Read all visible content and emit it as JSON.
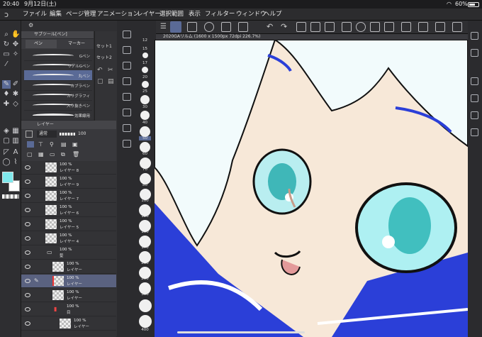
{
  "status": {
    "time": "20:40",
    "date": "9月12日(土)",
    "battery": "60%"
  },
  "menu": [
    "ファイル",
    "編集",
    "ページ管理",
    "アニメーション",
    "レイヤー",
    "選択範囲",
    "表示",
    "フィルター",
    "ウィンドウ",
    "ヘルプ"
  ],
  "subtool": {
    "title": "サブツール[ペン]",
    "tabs": [
      "ペン",
      "マーカー"
    ],
    "brushes": [
      "Gペン",
      "リアルGペン",
      "丸ペン",
      "カブラペン",
      "カリグラフィ",
      "入り抜きペン",
      "効果線用"
    ],
    "selected": 2
  },
  "sets": {
    "items": [
      "セット1",
      "セット2"
    ]
  },
  "sizes": [
    "12",
    "15",
    "17",
    "20",
    "25",
    "30",
    "40",
    "50",
    "60",
    "70",
    "80",
    "100",
    "120",
    "150",
    "170",
    "200",
    "250",
    "300",
    "400"
  ],
  "selected_size": "50",
  "layer_panel": {
    "title": "レイヤー",
    "blend": "通常",
    "opacity": "100"
  },
  "layers": [
    {
      "pct": "100 %",
      "name": "レイヤー 8"
    },
    {
      "pct": "100 %",
      "name": "レイヤー 9"
    },
    {
      "pct": "100 %",
      "name": "レイヤー 7"
    },
    {
      "pct": "100 %",
      "name": "レイヤー 6"
    },
    {
      "pct": "100 %",
      "name": "レイヤー 5"
    },
    {
      "pct": "100 %",
      "name": "レイヤー 4"
    },
    {
      "pct": "100 %",
      "name": "髪"
    },
    {
      "pct": "100 %",
      "name": "レイヤー"
    },
    {
      "pct": "100 %",
      "name": "レイヤー"
    },
    {
      "pct": "100 %",
      "name": "レイヤー"
    },
    {
      "pct": "100 %",
      "name": "目"
    },
    {
      "pct": "100 %",
      "name": "レイヤー"
    }
  ],
  "selected_layer": 8,
  "document": {
    "title": "2020GAリルム (1600 x 1500px 72dpi 226.7%)"
  },
  "colors": {
    "main": "#7fe8ec",
    "sub": "#ffffff"
  }
}
